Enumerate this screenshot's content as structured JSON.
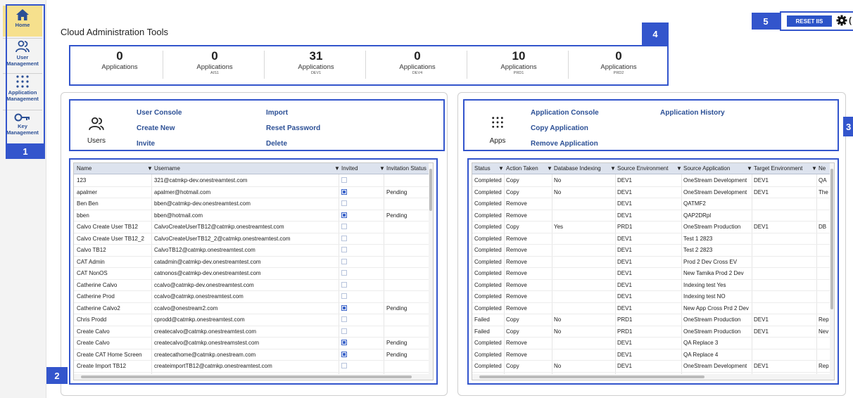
{
  "sidebar": {
    "items": [
      {
        "label": "Home",
        "icon": "home-icon"
      },
      {
        "label": "User Management",
        "icon": "users-icon"
      },
      {
        "label": "Application Management",
        "icon": "apps-grid-icon"
      },
      {
        "label": "Key Management",
        "icon": "key-icon"
      }
    ]
  },
  "badges": {
    "b1": "1",
    "b2": "2",
    "b3": "3",
    "b4": "4",
    "b5": "5"
  },
  "page": {
    "title": "Cloud Administration Tools"
  },
  "toolbar": {
    "reset_label": "RESET IIS",
    "gear_icon": "gear-icon",
    "trailing_text": "("
  },
  "stats": [
    {
      "value": "0",
      "label": "Applications",
      "sub": ""
    },
    {
      "value": "0",
      "label": "Applications",
      "sub": "AIS1"
    },
    {
      "value": "31",
      "label": "Applications",
      "sub": "DEV1"
    },
    {
      "value": "0",
      "label": "Applications",
      "sub": "DEV4"
    },
    {
      "value": "10",
      "label": "Applications",
      "sub": "PRD1"
    },
    {
      "value": "0",
      "label": "Applications",
      "sub": "PRD2"
    }
  ],
  "users_actions": {
    "label": "Users",
    "links": [
      "User Console",
      "Create New",
      "Invite",
      "Import",
      "Reset Password",
      "Delete"
    ]
  },
  "apps_actions": {
    "label": "Apps",
    "links": [
      "Application Console",
      "Copy Application",
      "Remove Application",
      "Application History"
    ]
  },
  "users_grid": {
    "columns": [
      "Name",
      "Username",
      "Invited",
      "Invitation Status"
    ],
    "rows": [
      {
        "name": "123",
        "username": "321@catmkp-dev.onestreamtest.com",
        "invited": false,
        "status": ""
      },
      {
        "name": "apalmer",
        "username": "apalmer@hotmail.com",
        "invited": true,
        "status": "Pending"
      },
      {
        "name": "Ben Ben",
        "username": "bben@catmkp-dev.onestreamtest.com",
        "invited": false,
        "status": ""
      },
      {
        "name": "bben",
        "username": "bben@hotmail.com",
        "invited": true,
        "status": "Pending"
      },
      {
        "name": "Calvo Create User TB12",
        "username": "CalvoCreateUserTB12@catmkp.onestreamtest.com",
        "invited": false,
        "status": ""
      },
      {
        "name": "Calvo Create User TB12_2",
        "username": "CalvoCreateUserTB12_2@catmkp.onestreamtest.com",
        "invited": false,
        "status": ""
      },
      {
        "name": "Calvo TB12",
        "username": "CalvoTB12@catmkp.onestreamtest.com",
        "invited": false,
        "status": ""
      },
      {
        "name": "CAT Admin",
        "username": "catadmin@catmkp-dev.onestreamtest.com",
        "invited": false,
        "status": ""
      },
      {
        "name": "CAT NonOS",
        "username": "catnonos@catmkp-dev.onestreamtest.com",
        "invited": false,
        "status": ""
      },
      {
        "name": "Catherine Calvo",
        "username": "ccalvo@catmkp-dev.onestreamtest.com",
        "invited": false,
        "status": ""
      },
      {
        "name": "Catherine Prod",
        "username": "ccalvo@catmkp.onestreamtest.com",
        "invited": false,
        "status": ""
      },
      {
        "name": "Catherine Calvo2",
        "username": "ccalvo@onestream2.com",
        "invited": true,
        "status": "Pending"
      },
      {
        "name": "Chris Prodd",
        "username": "cprodd@catmkp.onestreamtest.com",
        "invited": false,
        "status": ""
      },
      {
        "name": "Create Calvo",
        "username": "createcalvo@catmkp.onestreamtest.com",
        "invited": false,
        "status": ""
      },
      {
        "name": "Create Calvo",
        "username": "createcalvo@catmkp.onestreamstest.com",
        "invited": true,
        "status": "Pending"
      },
      {
        "name": "Create CAT Home Screen",
        "username": "createcathome@catmkp.onestream.com",
        "invited": true,
        "status": "Pending"
      },
      {
        "name": "Create Import TB12",
        "username": "createimportTB12@catmkp.onestreamtest.com",
        "invited": false,
        "status": ""
      }
    ]
  },
  "apps_grid": {
    "columns": [
      "Status",
      "Action Taken",
      "Database Indexing",
      "Source Environment",
      "Source Application",
      "Target Environment",
      "Ne"
    ],
    "rows": [
      {
        "status": "Completed",
        "action": "Copy",
        "indexing": "No",
        "src_env": "DEV1",
        "src_app": "OneStream Development",
        "tgt_env": "DEV1",
        "new": "QA"
      },
      {
        "status": "Completed",
        "action": "Copy",
        "indexing": "No",
        "src_env": "DEV1",
        "src_app": "OneStream Development",
        "tgt_env": "DEV1",
        "new": "The"
      },
      {
        "status": "Completed",
        "action": "Remove",
        "indexing": "",
        "src_env": "DEV1",
        "src_app": "QATMF2",
        "tgt_env": "",
        "new": ""
      },
      {
        "status": "Completed",
        "action": "Remove",
        "indexing": "",
        "src_env": "DEV1",
        "src_app": "QAP2DRpl",
        "tgt_env": "",
        "new": ""
      },
      {
        "status": "Completed",
        "action": "Copy",
        "indexing": "Yes",
        "src_env": "PRD1",
        "src_app": "OneStream Production",
        "tgt_env": "DEV1",
        "new": "DB"
      },
      {
        "status": "Completed",
        "action": "Remove",
        "indexing": "",
        "src_env": "DEV1",
        "src_app": "Test 1 2823",
        "tgt_env": "",
        "new": ""
      },
      {
        "status": "Completed",
        "action": "Remove",
        "indexing": "",
        "src_env": "DEV1",
        "src_app": "Test 2 2823",
        "tgt_env": "",
        "new": ""
      },
      {
        "status": "Completed",
        "action": "Remove",
        "indexing": "",
        "src_env": "DEV1",
        "src_app": "Prod 2 Dev Cross EV",
        "tgt_env": "",
        "new": ""
      },
      {
        "status": "Completed",
        "action": "Remove",
        "indexing": "",
        "src_env": "DEV1",
        "src_app": "New Tamika Prod 2 Dev",
        "tgt_env": "",
        "new": ""
      },
      {
        "status": "Completed",
        "action": "Remove",
        "indexing": "",
        "src_env": "DEV1",
        "src_app": "Indexing test Yes",
        "tgt_env": "",
        "new": ""
      },
      {
        "status": "Completed",
        "action": "Remove",
        "indexing": "",
        "src_env": "DEV1",
        "src_app": "Indexing test  NO",
        "tgt_env": "",
        "new": ""
      },
      {
        "status": "Completed",
        "action": "Remove",
        "indexing": "",
        "src_env": "DEV1",
        "src_app": "New App Cross Prd 2 Dev",
        "tgt_env": "",
        "new": ""
      },
      {
        "status": "Failed",
        "action": "Copy",
        "indexing": "No",
        "src_env": "PRD1",
        "src_app": "OneStream Production",
        "tgt_env": "DEV1",
        "new": "Rep"
      },
      {
        "status": "Failed",
        "action": "Copy",
        "indexing": "No",
        "src_env": "PRD1",
        "src_app": "OneStream Production",
        "tgt_env": "DEV1",
        "new": "Nev"
      },
      {
        "status": "Completed",
        "action": "Remove",
        "indexing": "",
        "src_env": "DEV1",
        "src_app": "QA Replace 3",
        "tgt_env": "",
        "new": ""
      },
      {
        "status": "Completed",
        "action": "Remove",
        "indexing": "",
        "src_env": "DEV1",
        "src_app": "QA Replace 4",
        "tgt_env": "",
        "new": ""
      },
      {
        "status": "Completed",
        "action": "Copy",
        "indexing": "No",
        "src_env": "DEV1",
        "src_app": "OneStream Development",
        "tgt_env": "DEV1",
        "new": "Rep"
      }
    ]
  },
  "colors": {
    "accent": "#3355cc",
    "link": "#2b4f95",
    "home_highlight": "#f6e08d",
    "header_bg": "#dde3ee"
  }
}
